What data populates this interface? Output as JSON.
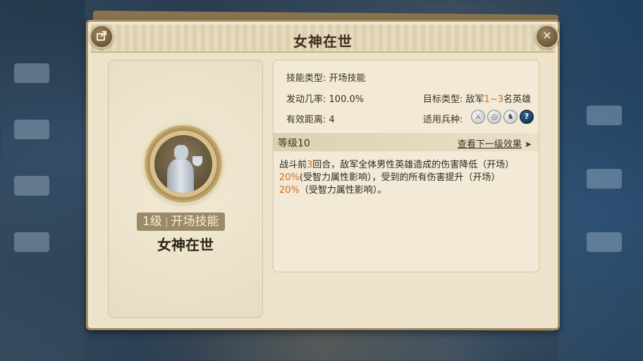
{
  "window": {
    "title": "女神在世",
    "share_icon": "share-icon",
    "close_icon": "close-icon",
    "close_glyph": "✕"
  },
  "skill_card": {
    "level": "1级",
    "separator": "|",
    "type": "开场技能",
    "name": "女神在世"
  },
  "details": {
    "skill_type_label": "技能类型:",
    "skill_type_value": "开场技能",
    "trigger_rate_label": "发动几率:",
    "trigger_rate_value": "100.0%",
    "target_type_label": "目标类型:",
    "target_prefix": "敌军",
    "target_range": "1~3",
    "target_suffix": "名英雄",
    "range_label": "有效距离:",
    "range_value": "4",
    "troop_label": "适用兵种:",
    "troop_icons": [
      "sword-icon",
      "target-icon",
      "horse-icon",
      "question-icon"
    ],
    "troop_glyphs": [
      "⚔",
      "◎",
      "♞",
      "?"
    ]
  },
  "level_section": {
    "level_label": "等级10",
    "next_level_link": "查看下一级效果",
    "arrow": "➤"
  },
  "description": {
    "part1": "战斗前",
    "rounds": "3",
    "part2": "回合，敌军全体男性英雄造成的伤害降低（开场）",
    "pct1": "20%",
    "part3": "(受智力属性影响），受到的所有伤害提升（开场）",
    "pct2": "20%",
    "part4": "（受智力属性影响）。"
  },
  "colors": {
    "accent_orange": "#d86a1c",
    "panel_bg": "#ede3cb",
    "text_dark": "#3a3022"
  }
}
